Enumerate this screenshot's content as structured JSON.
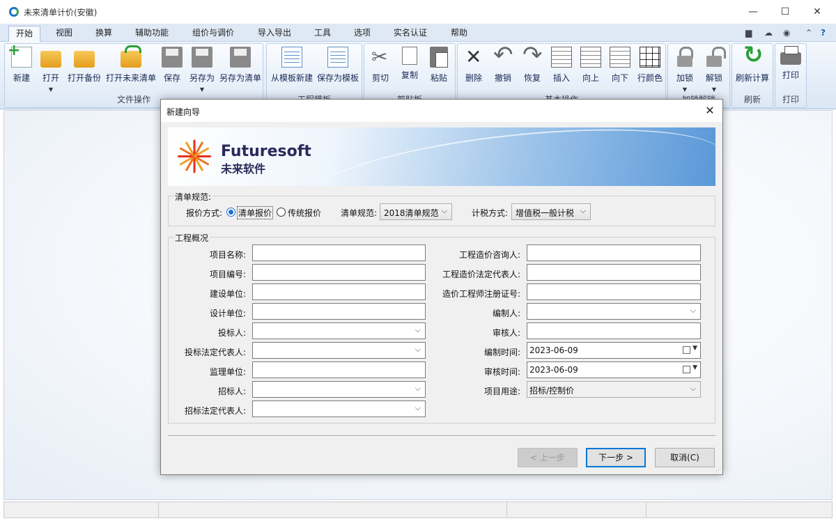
{
  "window": {
    "title": "未来清单计价(安徽)"
  },
  "menu": {
    "tabs": [
      "开始",
      "视图",
      "换算",
      "辅助功能",
      "组价与调价",
      "导入导出",
      "工具",
      "选项",
      "实名认证",
      "帮助"
    ]
  },
  "ribbon": {
    "groups": {
      "file": "文件操作",
      "template": "工程模板",
      "clipboard": "剪贴板",
      "basic": "基本操作",
      "lock": "加锁解锁",
      "refresh": "刷新",
      "print": "打印"
    },
    "buttons": {
      "new": "新建",
      "open": "打开",
      "open_backup": "打开备份",
      "open_future": "打开未来清单",
      "save": "保存",
      "save_as": "另存为",
      "save_as_list": "另存为清单",
      "from_template": "从模板新建",
      "save_template": "保存为模板",
      "cut": "剪切",
      "copy": "复制",
      "paste": "粘贴",
      "delete": "删除",
      "undo": "撤销",
      "redo": "恢复",
      "insert": "插入",
      "up": "向上",
      "down": "向下",
      "row_color": "行颜色",
      "lock": "加锁",
      "unlock": "解锁",
      "refresh_calc": "刷新计算",
      "print": "打印"
    }
  },
  "dialog": {
    "title": "新建向导",
    "banner": {
      "logo_en": "Futuresoft",
      "logo_cn": "未来软件"
    },
    "spec_section": {
      "legend": "清单规范:",
      "quote_label": "报价方式:",
      "quote_options": [
        "清单报价",
        "传统报价"
      ],
      "quote_selected": "清单报价",
      "spec_label": "清单规范:",
      "spec_value": "2018清单规范",
      "tax_label": "计税方式:",
      "tax_value": "增值税一般计税"
    },
    "project_section": {
      "legend": "工程概况",
      "left_fields": [
        {
          "label": "项目名称:",
          "value": ""
        },
        {
          "label": "项目编号:",
          "value": ""
        },
        {
          "label": "建设单位:",
          "value": ""
        },
        {
          "label": "设计单位:",
          "value": ""
        },
        {
          "label": "投标人:",
          "value": ""
        },
        {
          "label": "投标法定代表人:",
          "value": ""
        },
        {
          "label": "监理单位:",
          "value": ""
        },
        {
          "label": "招标人:",
          "value": ""
        },
        {
          "label": "招标法定代表人:",
          "value": ""
        }
      ],
      "right_fields": [
        {
          "label": "工程造价咨询人:",
          "value": ""
        },
        {
          "label": "工程造价法定代表人:",
          "value": ""
        },
        {
          "label": "造价工程师注册证号:",
          "value": ""
        },
        {
          "label": "编制人:",
          "value": ""
        },
        {
          "label": "审核人:",
          "value": ""
        },
        {
          "label": "编制时间:",
          "value": "2023-06-09"
        },
        {
          "label": "审核时间:",
          "value": "2023-06-09"
        },
        {
          "label": "项目用途:",
          "value": "招标/控制价"
        }
      ]
    },
    "buttons": {
      "prev": "< 上一步",
      "next": "下一步 >",
      "cancel": "取消(C)"
    }
  }
}
